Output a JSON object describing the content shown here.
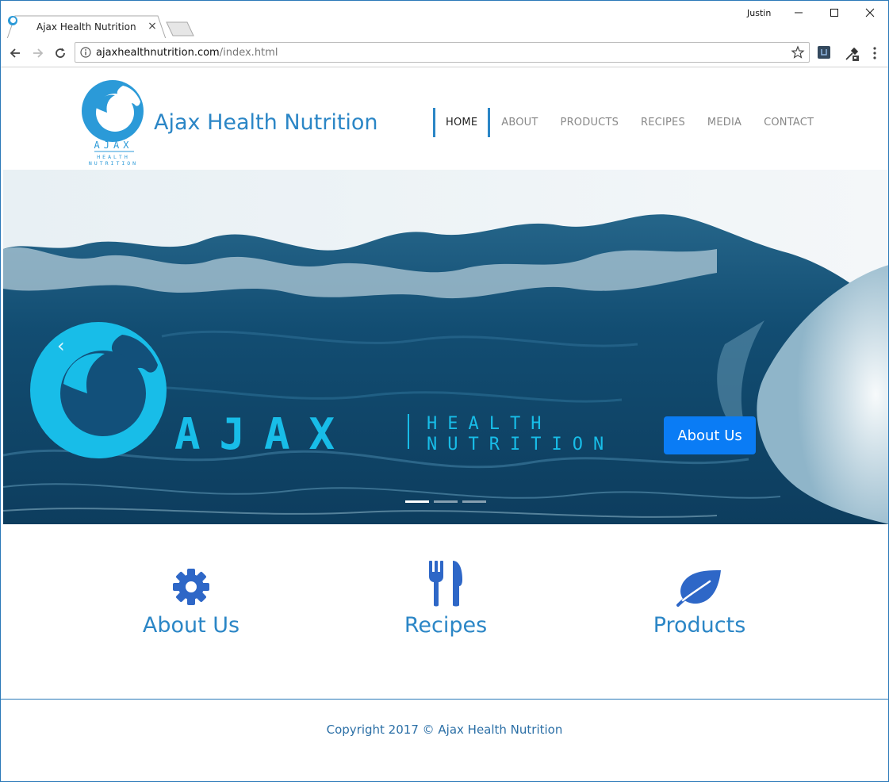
{
  "browser": {
    "tab_title": "Ajax Health Nutrition",
    "tab_close": "×",
    "user_name": "Justin",
    "url_host": "ajaxhealthnutrition.com",
    "url_path": "/index.html",
    "icons": [
      "back-arrow-icon",
      "forward-arrow-icon",
      "reload-icon",
      "info-icon",
      "star-icon",
      "extension-icon",
      "eyedropper-icon",
      "menu-dots-icon"
    ]
  },
  "site": {
    "brand": "Ajax Health Nutrition",
    "logo_text": [
      "AJAX",
      "HEALTH",
      "NUTRITION"
    ],
    "nav": [
      "HOME",
      "ABOUT",
      "PRODUCTS",
      "RECIPES",
      "MEDIA",
      "CONTACT"
    ],
    "active_nav": "HOME",
    "accent_color": "#2b86c6"
  },
  "hero": {
    "logo_word": "AJAX",
    "logo_sub_1": "HEALTH",
    "logo_sub_2": "NUTRITION",
    "button_label": "About Us",
    "button_color": "#0a7cf5",
    "prev_arrow": "‹",
    "slides": 3,
    "active_slide": 1
  },
  "features": [
    {
      "label": "About Us",
      "icon": "gear-icon"
    },
    {
      "label": "Recipes",
      "icon": "utensils-icon"
    },
    {
      "label": "Products",
      "icon": "leaf-icon"
    }
  ],
  "footer": {
    "copyright": "Copyright 2017 © Ajax Health Nutrition"
  }
}
